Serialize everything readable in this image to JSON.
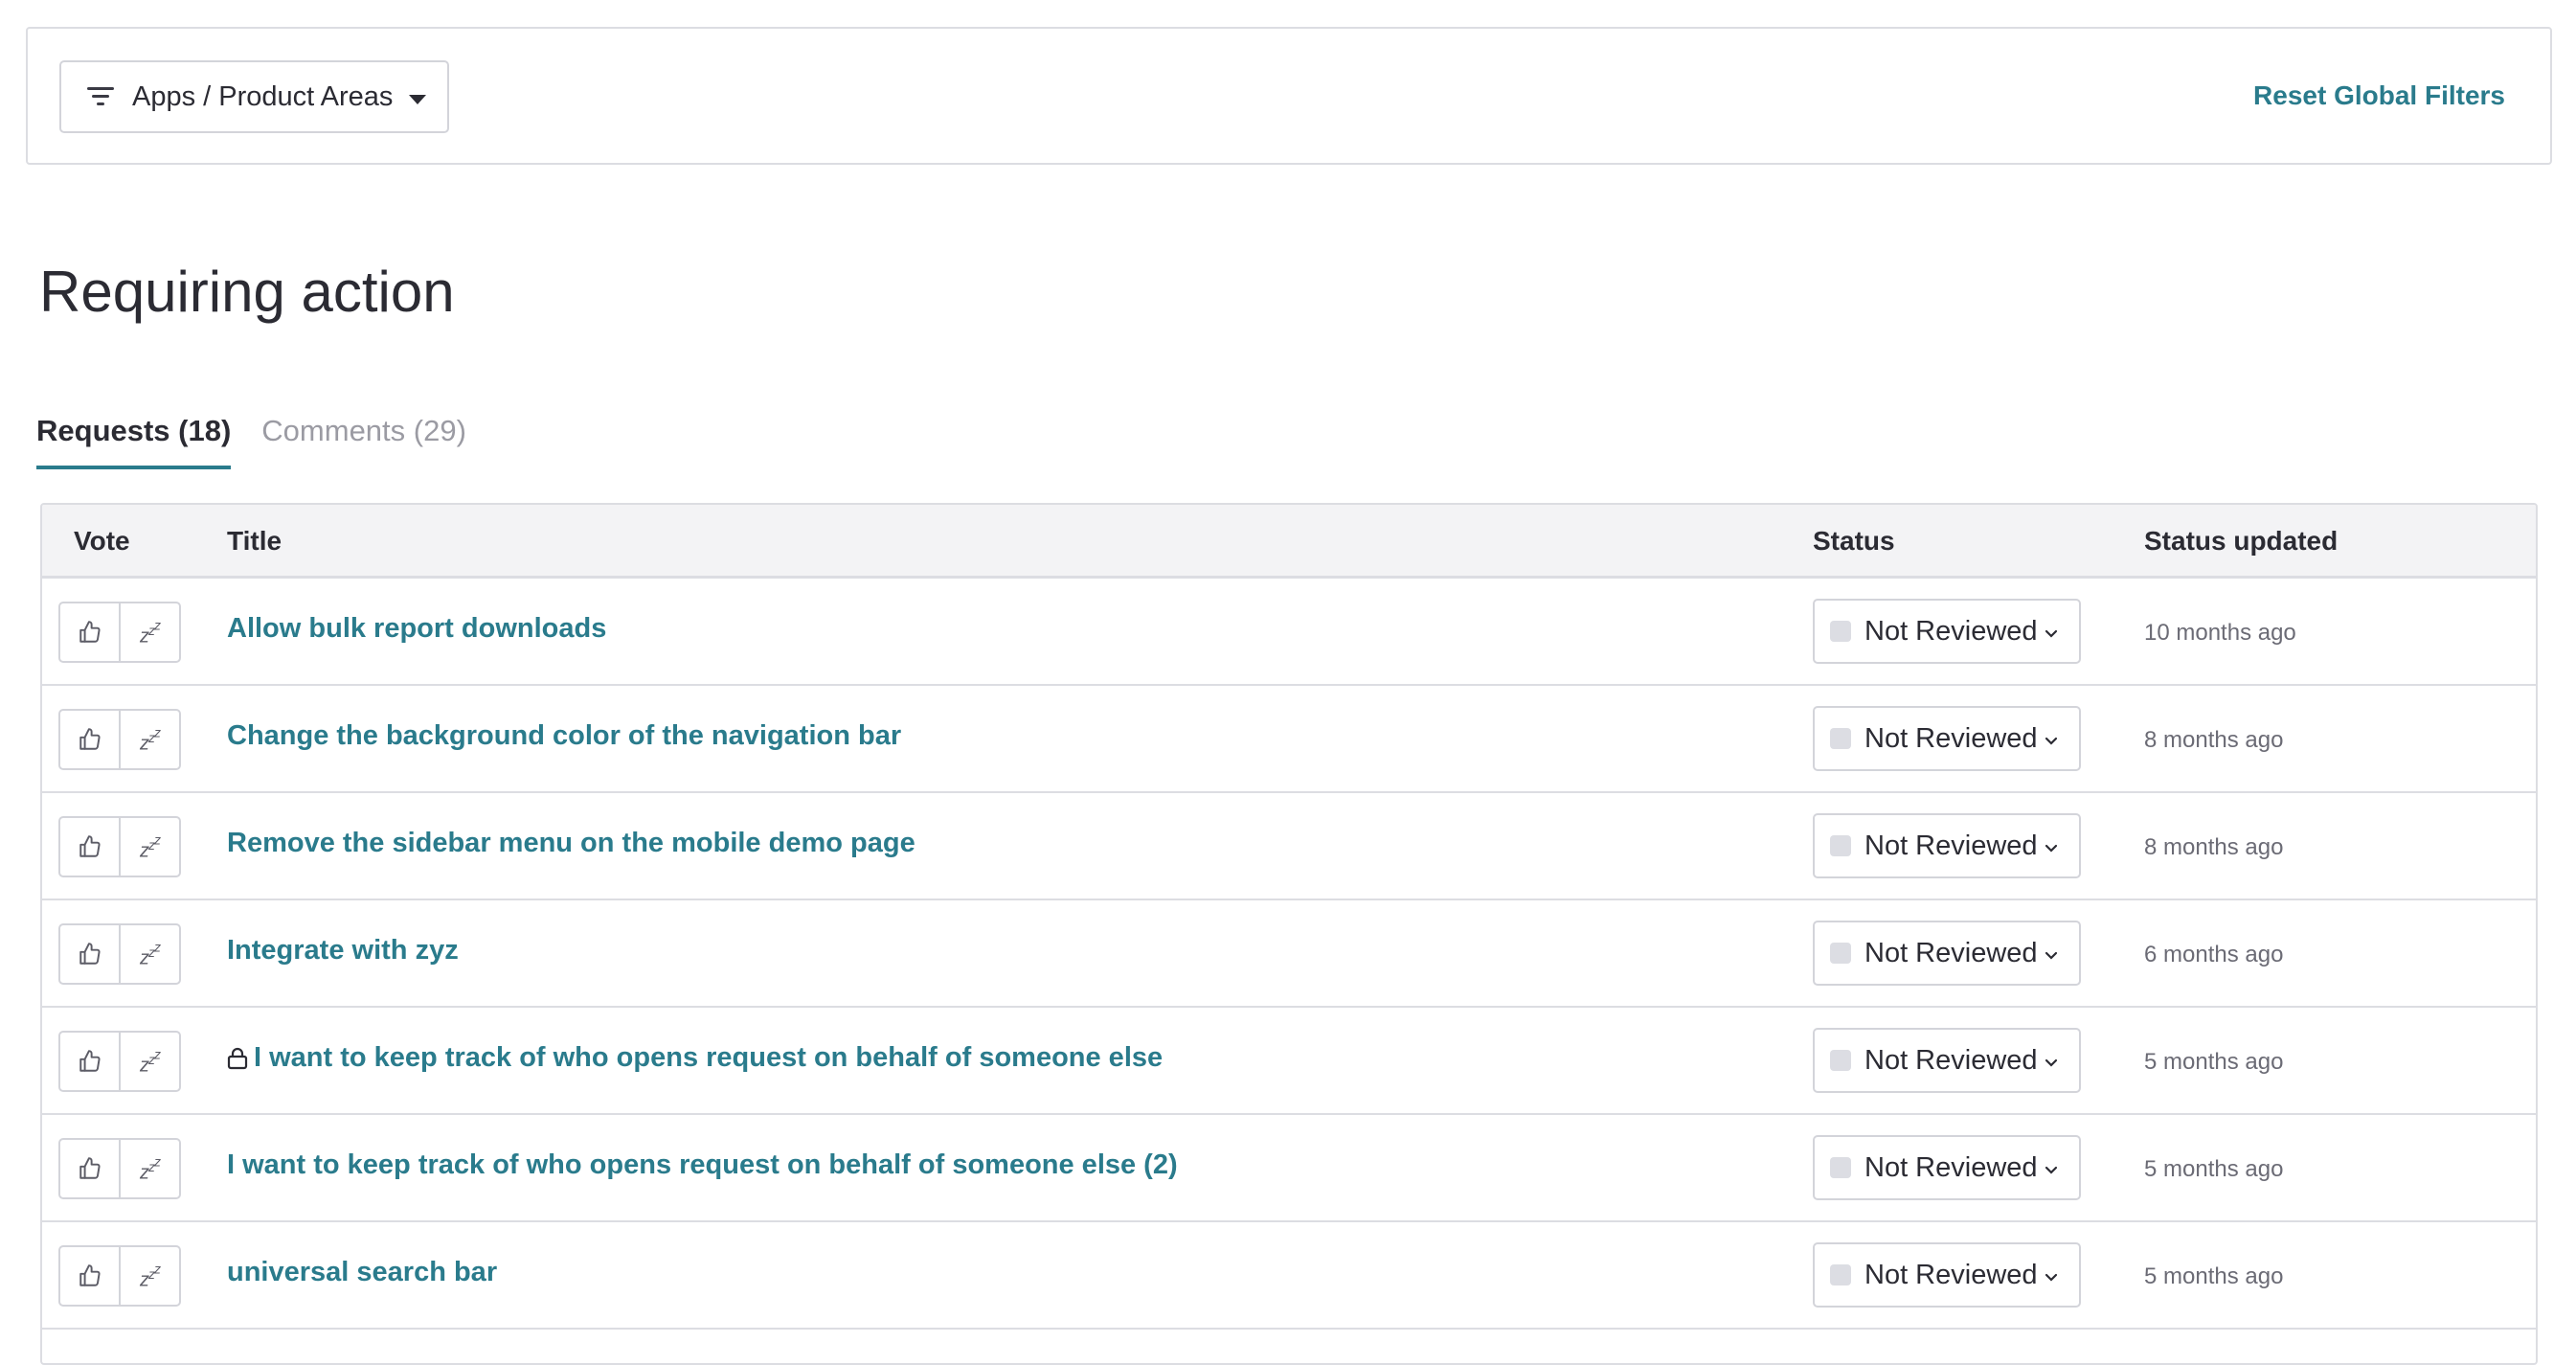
{
  "filter_bar": {
    "dropdown_label": "Apps / Product Areas",
    "reset_label": "Reset Global Filters"
  },
  "page_title": "Requiring action",
  "tabs": [
    {
      "label": "Requests (18)",
      "active": true
    },
    {
      "label": "Comments (29)",
      "active": false
    }
  ],
  "table": {
    "columns": {
      "vote": "Vote",
      "title": "Title",
      "status": "Status",
      "status_updated": "Status updated"
    },
    "rows": [
      {
        "title": "Allow bulk report downloads",
        "locked": false,
        "status": "Not Reviewed",
        "updated": "10 months ago"
      },
      {
        "title": "Change the background color of the navigation bar",
        "locked": false,
        "status": "Not Reviewed",
        "updated": "8 months ago"
      },
      {
        "title": "Remove the sidebar menu on the mobile demo page",
        "locked": false,
        "status": "Not Reviewed",
        "updated": "8 months ago"
      },
      {
        "title": "Integrate with zyz",
        "locked": false,
        "status": "Not Reviewed",
        "updated": "6 months ago"
      },
      {
        "title": "I want to keep track of who opens request on behalf of someone else",
        "locked": true,
        "status": "Not Reviewed",
        "updated": "5 months ago"
      },
      {
        "title": "I want to keep track of who opens request on behalf of someone else (2)",
        "locked": false,
        "status": "Not Reviewed",
        "updated": "5 months ago"
      },
      {
        "title": "universal search bar",
        "locked": false,
        "status": "Not Reviewed",
        "updated": "5 months ago"
      }
    ]
  },
  "icons": {
    "filter": "filter-icon",
    "caret": "caret-down-icon",
    "upvote": "thumbs-up-icon",
    "snooze": "snooze-icon",
    "lock": "lock-icon",
    "chevron": "chevron-down-icon"
  },
  "colors": {
    "accent": "#2a7b8c",
    "border": "#dcdde2",
    "header_bg": "#f3f3f5",
    "status_swatch": "#dcdde3"
  }
}
